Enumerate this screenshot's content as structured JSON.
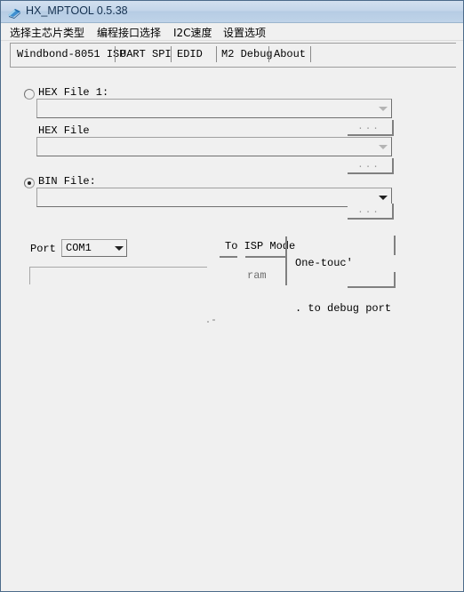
{
  "window": {
    "title": "HX_MPTOOL 0.5.38",
    "icon": "app-icon",
    "background_color": "#f0f0f0",
    "titlebar_color": "#bfd3e8"
  },
  "menu": {
    "items": [
      {
        "label": "选择主芯片类型"
      },
      {
        "label": "编程接口选择"
      },
      {
        "label": "I2C速度"
      },
      {
        "label": "设置选项"
      }
    ]
  },
  "tabs": {
    "selected": "Windbond-8051 ISP",
    "items": [
      {
        "label": "Windbond-8051 ISP"
      },
      {
        "label": "UART SPI"
      },
      {
        "label": "EDID"
      },
      {
        "label": "M2 Debug"
      },
      {
        "label": "About"
      }
    ]
  },
  "main": {
    "hex_file_1": {
      "radio_label": "HEX File 1:",
      "selected": false,
      "combo_value": "",
      "browse_label": "..."
    },
    "hex_file_2": {
      "label": "HEX File",
      "combo_value": "",
      "browse_label": "..."
    },
    "bin_file": {
      "radio_label": "BIN File:",
      "selected": true,
      "combo_value": "",
      "browse_label": "..."
    },
    "port": {
      "label": "Port",
      "value": "COM1",
      "options": [
        "COM1"
      ]
    },
    "buttons": {
      "to_isp_mode": "To ISP Mode",
      "program": "ram",
      "one_touch": "One-touc'"
    },
    "notes": {
      "debug_port": ". to debug port"
    }
  }
}
